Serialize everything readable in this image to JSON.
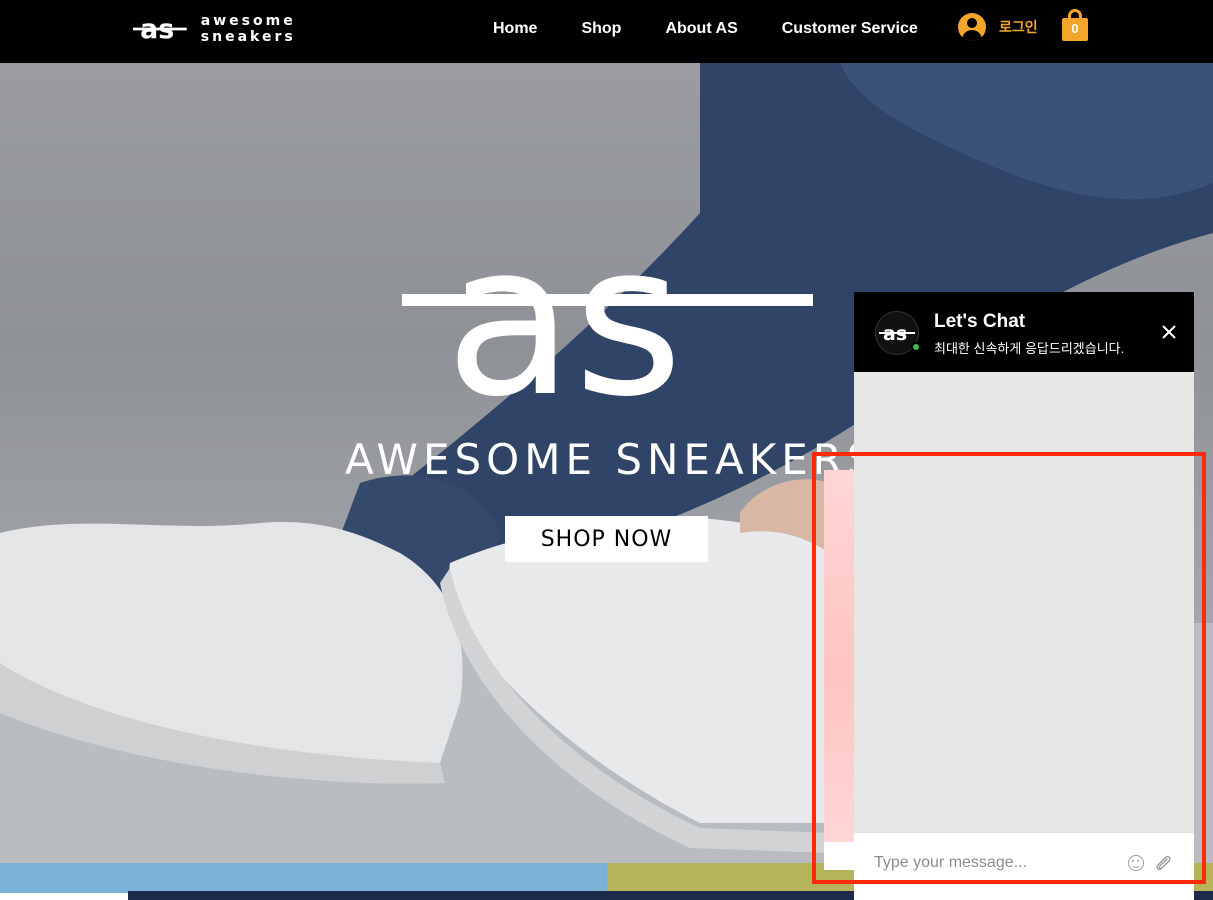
{
  "header": {
    "brand": "awesome sneakers",
    "nav": [
      "Home",
      "Shop",
      "About AS",
      "Customer Service"
    ],
    "login_label": "로그인",
    "cart_count": "0"
  },
  "hero": {
    "title": "AWESOME SNEAKERS",
    "cta": "SHOP NOW"
  },
  "chat": {
    "title": "Let's Chat",
    "subtitle": "최대한 신속하게 응답드리겠습니다.",
    "input_placeholder": "Type your message..."
  },
  "colors": {
    "accent": "#f4a52c",
    "header_bg": "#000000",
    "online": "#3cbf4a",
    "highlight": "#ff2a0a"
  }
}
